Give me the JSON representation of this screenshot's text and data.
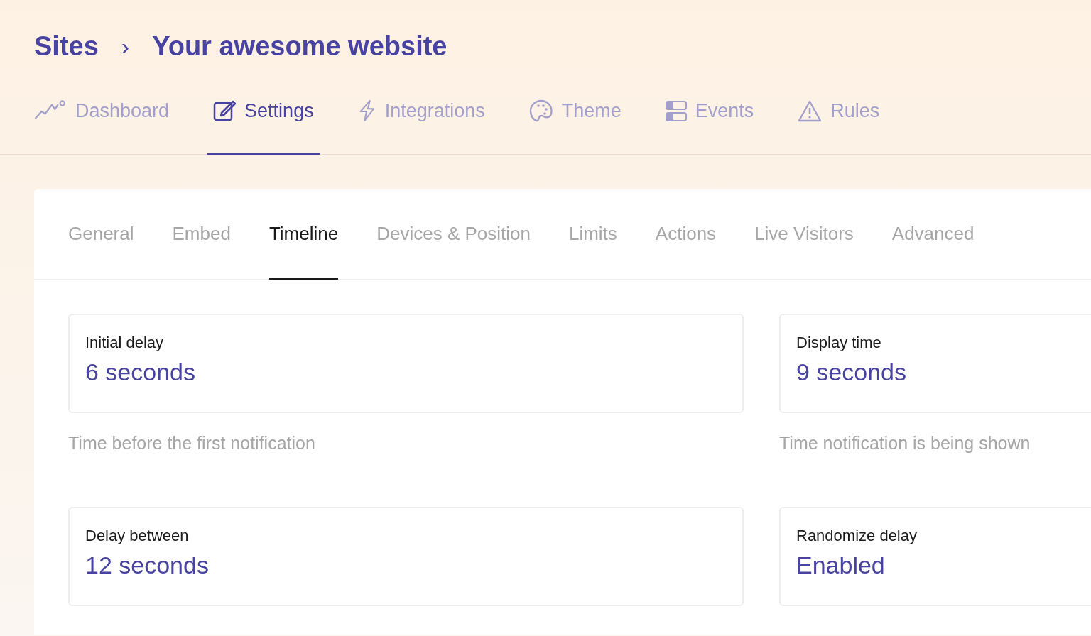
{
  "breadcrumb": {
    "parent": "Sites",
    "separator": "›",
    "current": "Your awesome website"
  },
  "nav_tabs": [
    {
      "label": "Dashboard",
      "selected": false
    },
    {
      "label": "Settings",
      "selected": true
    },
    {
      "label": "Integrations",
      "selected": false
    },
    {
      "label": "Theme",
      "selected": false
    },
    {
      "label": "Events",
      "selected": false
    },
    {
      "label": "Rules",
      "selected": false
    }
  ],
  "settings_tabs": [
    {
      "label": "General",
      "selected": false
    },
    {
      "label": "Embed",
      "selected": false
    },
    {
      "label": "Timeline",
      "selected": true
    },
    {
      "label": "Devices & Position",
      "selected": false
    },
    {
      "label": "Limits",
      "selected": false
    },
    {
      "label": "Actions",
      "selected": false
    },
    {
      "label": "Live Visitors",
      "selected": false
    },
    {
      "label": "Advanced",
      "selected": false
    }
  ],
  "fields": [
    {
      "label": "Initial delay",
      "value": "6 seconds",
      "help": "Time before the first notification"
    },
    {
      "label": "Display time",
      "value": "9 seconds",
      "help": "Time notification is being shown"
    },
    {
      "label": "Delay between",
      "value": "12 seconds"
    },
    {
      "label": "Randomize delay",
      "value": "Enabled"
    }
  ]
}
